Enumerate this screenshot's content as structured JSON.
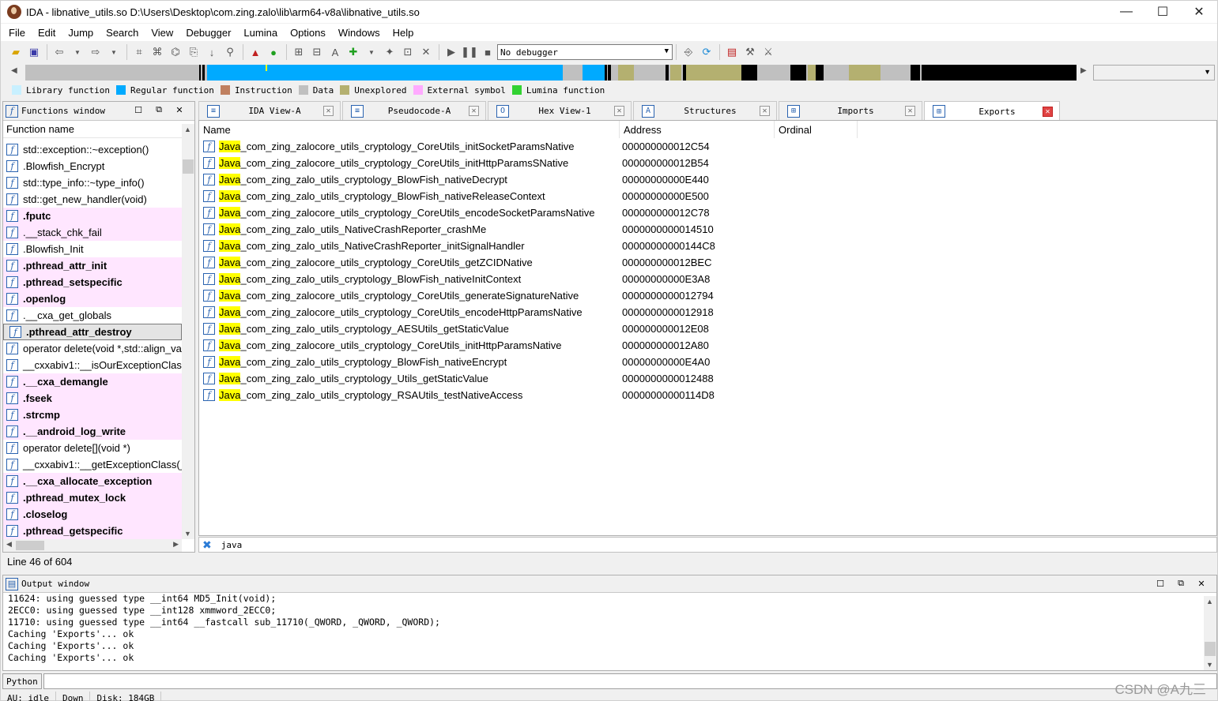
{
  "window": {
    "title": "IDA - libnative_utils.so D:\\Users\\Desktop\\com.zing.zalo\\lib\\arm64-v8a\\libnative_utils.so",
    "minimize": "—",
    "maximize": "☐",
    "close": "✕"
  },
  "menu": [
    "File",
    "Edit",
    "Jump",
    "Search",
    "View",
    "Debugger",
    "Lumina",
    "Options",
    "Windows",
    "Help"
  ],
  "toolbar": {
    "debugger_select": "No debugger"
  },
  "legend": [
    {
      "label": "Library function",
      "color": "#c8f0ff"
    },
    {
      "label": "Regular function",
      "color": "#00aaff"
    },
    {
      "label": "Instruction",
      "color": "#c08060"
    },
    {
      "label": "Data",
      "color": "#c0c0c0"
    },
    {
      "label": "Unexplored",
      "color": "#b4b070"
    },
    {
      "label": "External symbol",
      "color": "#ffaaff"
    },
    {
      "label": "Lumina function",
      "color": "#32d232"
    }
  ],
  "functions_window": {
    "title": "Functions window",
    "column": "Function name",
    "items": [
      {
        "name": "std::exception::~exception()",
        "type": "regular"
      },
      {
        "name": ".Blowfish_Encrypt",
        "type": "regular"
      },
      {
        "name": "std::type_info::~type_info()",
        "type": "regular"
      },
      {
        "name": "std::get_new_handler(void)",
        "type": "regular"
      },
      {
        "name": ".fputc",
        "type": "ext-bold"
      },
      {
        "name": ".__stack_chk_fail",
        "type": "ext"
      },
      {
        "name": ".Blowfish_Init",
        "type": "regular"
      },
      {
        "name": ".pthread_attr_init",
        "type": "ext-bold"
      },
      {
        "name": ".pthread_setspecific",
        "type": "ext-bold"
      },
      {
        "name": ".openlog",
        "type": "ext-bold"
      },
      {
        "name": ".__cxa_get_globals",
        "type": "regular"
      },
      {
        "name": ".pthread_attr_destroy",
        "type": "sel-bold"
      },
      {
        "name": "operator delete(void *,std::align_val_t)",
        "type": "regular"
      },
      {
        "name": "__cxxabiv1::__isOurExceptionClass(_Unwind_Exception const*)",
        "type": "regular"
      },
      {
        "name": ".__cxa_demangle",
        "type": "ext-bold"
      },
      {
        "name": ".fseek",
        "type": "ext-bold"
      },
      {
        "name": ".strcmp",
        "type": "ext-bold"
      },
      {
        "name": ".__android_log_write",
        "type": "ext-bold"
      },
      {
        "name": "operator delete[](void *)",
        "type": "regular"
      },
      {
        "name": "__cxxabiv1::__getExceptionClass(_Unwind_Exception const*)",
        "type": "regular"
      },
      {
        "name": ".__cxa_allocate_exception",
        "type": "ext-bold"
      },
      {
        "name": ".pthread_mutex_lock",
        "type": "ext-bold"
      },
      {
        "name": ".closelog",
        "type": "ext-bold"
      },
      {
        "name": ".pthread_getspecific",
        "type": "ext-bold"
      }
    ],
    "status": "Line 46 of 604"
  },
  "tabs": [
    {
      "label": "IDA View-A",
      "icon": "≡"
    },
    {
      "label": "Pseudocode-A",
      "icon": "≡"
    },
    {
      "label": "Hex View-1",
      "icon": "O"
    },
    {
      "label": "Structures",
      "icon": "A"
    },
    {
      "label": "Imports",
      "icon": "⊞"
    },
    {
      "label": "Exports",
      "icon": "⊞"
    }
  ],
  "exports": {
    "columns": [
      "Name",
      "Address",
      "Ordinal"
    ],
    "highlight": "Java",
    "rows": [
      {
        "name": "_com_zing_zalocore_utils_cryptology_CoreUtils_initSocketParamsNative",
        "address": "000000000012C54"
      },
      {
        "name": "_com_zing_zalocore_utils_cryptology_CoreUtils_initHttpParamsSNative",
        "address": "000000000012B54"
      },
      {
        "name": "_com_zing_zalo_utils_cryptology_BlowFish_nativeDecrypt",
        "address": "00000000000E440"
      },
      {
        "name": "_com_zing_zalo_utils_cryptology_BlowFish_nativeReleaseContext",
        "address": "00000000000E500"
      },
      {
        "name": "_com_zing_zalocore_utils_cryptology_CoreUtils_encodeSocketParamsNative",
        "address": "000000000012C78"
      },
      {
        "name": "_com_zing_zalo_utils_NativeCrashReporter_crashMe",
        "address": "0000000000014510"
      },
      {
        "name": "_com_zing_zalo_utils_NativeCrashReporter_initSignalHandler",
        "address": "00000000000144C8"
      },
      {
        "name": "_com_zing_zalocore_utils_cryptology_CoreUtils_getZCIDNative",
        "address": "000000000012BEC"
      },
      {
        "name": "_com_zing_zalo_utils_cryptology_BlowFish_nativeInitContext",
        "address": "00000000000E3A8"
      },
      {
        "name": "_com_zing_zalocore_utils_cryptology_CoreUtils_generateSignatureNative",
        "address": "0000000000012794"
      },
      {
        "name": "_com_zing_zalocore_utils_cryptology_CoreUtils_encodeHttpParamsNative",
        "address": "0000000000012918"
      },
      {
        "name": "_com_zing_zalo_utils_cryptology_AESUtils_getStaticValue",
        "address": "000000000012E08"
      },
      {
        "name": "_com_zing_zalocore_utils_cryptology_CoreUtils_initHttpParamsNative",
        "address": "000000000012A80"
      },
      {
        "name": "_com_zing_zalo_utils_cryptology_BlowFish_nativeEncrypt",
        "address": "00000000000E4A0"
      },
      {
        "name": "_com_zing_zalo_utils_cryptology_Utils_getStaticValue",
        "address": "0000000000012488"
      },
      {
        "name": "_com_zing_zalo_utils_cryptology_RSAUtils_testNativeAccess",
        "address": "00000000000114D8"
      }
    ]
  },
  "filter": {
    "value": "java"
  },
  "output": {
    "title": "Output window",
    "lines": [
      "11624: using guessed type __int64 MD5_Init(void);",
      "2ECC0: using guessed type __int128 xmmword_2ECC0;",
      "11710: using guessed type __int64 __fastcall sub_11710(_QWORD, _QWORD, _QWORD);",
      "Caching 'Exports'... ok",
      "Caching 'Exports'... ok",
      "Caching 'Exports'... ok"
    ]
  },
  "python_button": "Python",
  "status": {
    "au": "AU:  idle",
    "dir": "Down",
    "disk": "Disk: 184GB"
  },
  "watermark": "CSDN @A九三"
}
